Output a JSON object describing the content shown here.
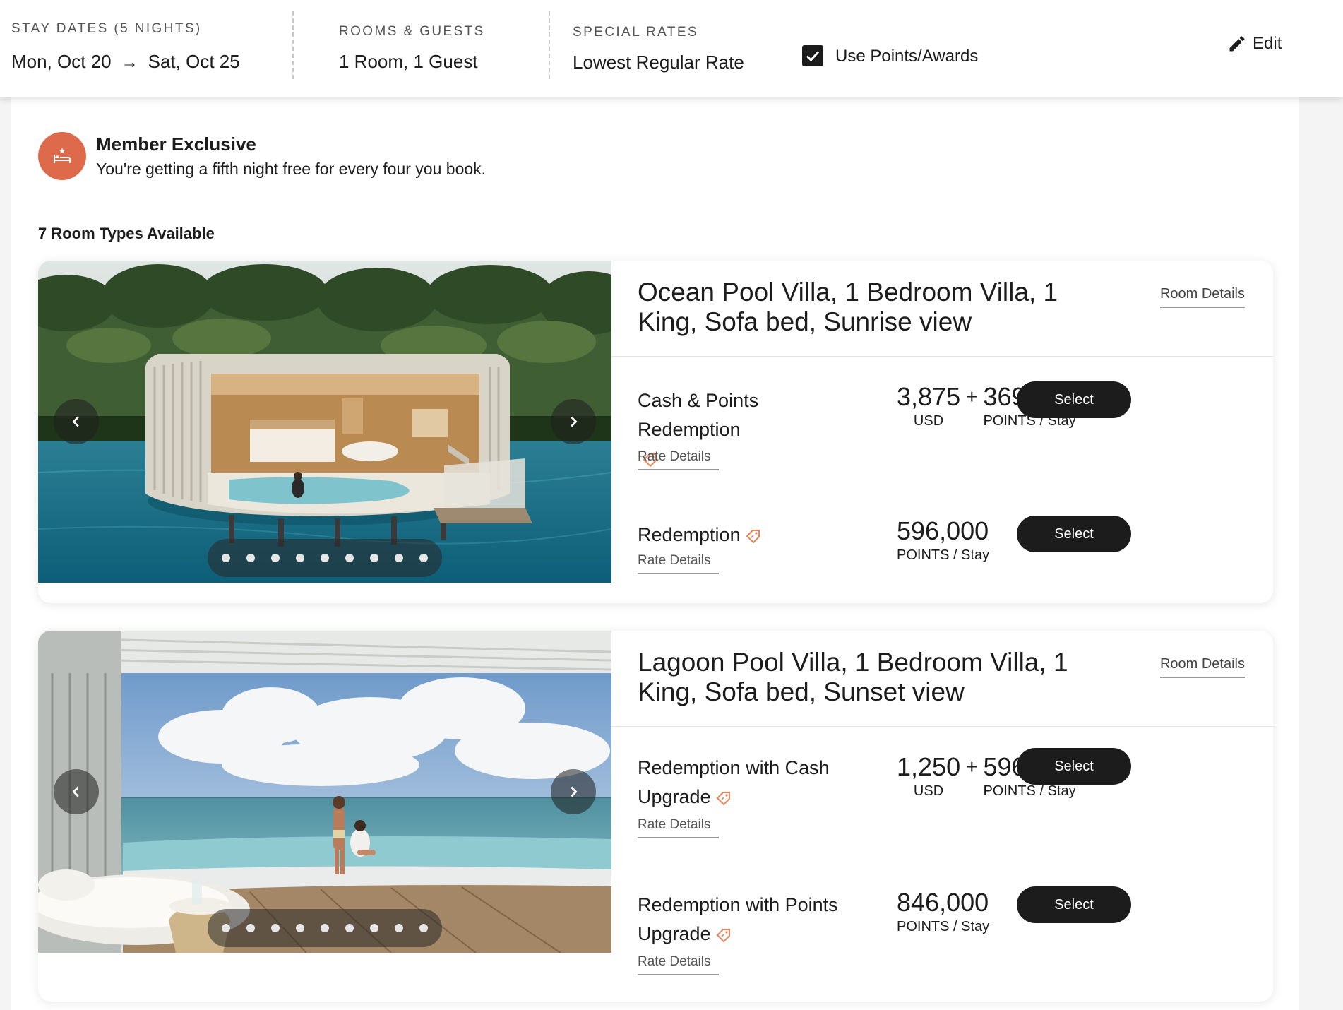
{
  "search": {
    "stay_dates_label": "STAY DATES (5 NIGHTS)",
    "check_in": "Mon, Oct 20",
    "arrow": "→",
    "check_out": "Sat, Oct 25",
    "rooms_label": "ROOMS & GUESTS",
    "rooms_value": "1 Room, 1 Guest",
    "rates_label": "SPECIAL RATES",
    "rates_value": "Lowest Regular Rate",
    "use_points_label": "Use Points/Awards",
    "use_points_checked": true,
    "edit_label": "Edit"
  },
  "member": {
    "title": "Member Exclusive",
    "subtitle": "You're getting a fifth night free for every four you book.",
    "badge_color": "#de6a4c"
  },
  "room_count": "7 Room Types Available",
  "rooms": [
    {
      "title": "Ocean Pool Villa, 1 Bedroom Villa, 1 King, Sofa bed, Sunrise view",
      "details_link": "Room Details",
      "photo_count": 9,
      "rates": [
        {
          "name": "Cash & Points Redemption",
          "link": "Rate Details",
          "cash": "3,875",
          "cash_unit": "USD",
          "points": "369,000",
          "points_unit": "POINTS / Stay",
          "button": "Select"
        },
        {
          "name": "Redemption",
          "link": "Rate Details",
          "points": "596,000",
          "points_unit": "POINTS / Stay",
          "button": "Select"
        }
      ]
    },
    {
      "title": "Lagoon Pool Villa, 1 Bedroom Villa, 1 King, Sofa bed, Sunset view",
      "details_link": "Room Details",
      "photo_count": 9,
      "rates": [
        {
          "name": "Redemption with Cash Upgrade",
          "link": "Rate Details",
          "cash": "1,250",
          "cash_unit": "USD",
          "points": "596,000",
          "points_unit": "POINTS / Stay",
          "button": "Select"
        },
        {
          "name": "Redemption with Points Upgrade",
          "link": "Rate Details",
          "points": "846,000",
          "points_unit": "POINTS / Stay",
          "button": "Select"
        }
      ]
    }
  ],
  "colors": {
    "accent": "#1c1c1c",
    "tag": "#e8845a",
    "badge": "#de6a4c"
  }
}
